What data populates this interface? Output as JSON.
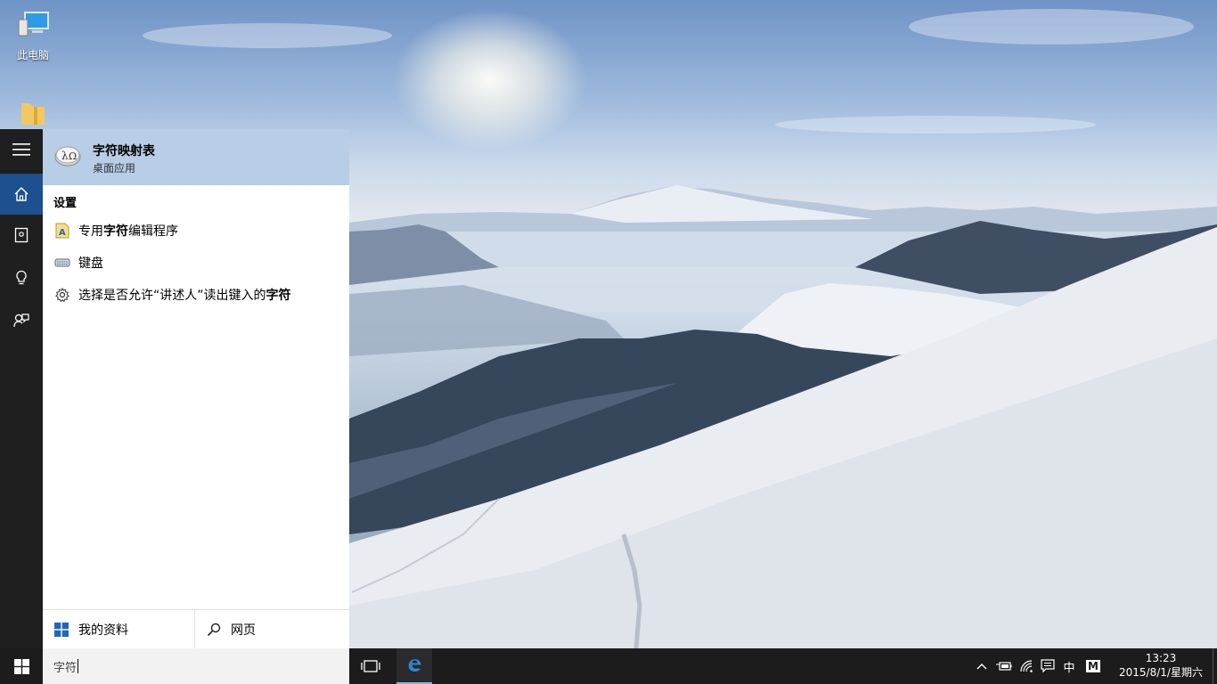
{
  "desktop": {
    "icons": [
      {
        "label": "此电脑",
        "icon": "computer-icon"
      },
      {
        "label": "",
        "icon": "folder-icon"
      }
    ]
  },
  "start_rail": {
    "items": [
      {
        "icon": "hamburger-menu-icon"
      },
      {
        "icon": "home-icon",
        "active": true
      },
      {
        "icon": "notebook-icon"
      },
      {
        "icon": "lightbulb-icon"
      },
      {
        "icon": "feedback-icon"
      }
    ]
  },
  "search_results": {
    "best_match": {
      "title": "字符映射表",
      "subtitle": "桌面应用",
      "icon": "character-map-icon"
    },
    "settings_header": "设置",
    "settings": [
      {
        "prefix": "专用",
        "bold": "字符",
        "suffix": "编辑程序",
        "icon": "edit-char-icon"
      },
      {
        "prefix": "键盘",
        "bold": "",
        "suffix": "",
        "icon": "keyboard-icon"
      },
      {
        "prefix": "选择是否允许“讲述人”读出键入的",
        "bold": "字符",
        "suffix": "",
        "icon": "gear-icon"
      }
    ],
    "tabs": {
      "my_stuff": "我的资料",
      "web": "网页"
    }
  },
  "taskbar": {
    "search_value": "字符",
    "tray": {
      "ime": "中",
      "ime_mode": "M"
    },
    "clock": {
      "time": "13:23",
      "date": "2015/8/1/星期六"
    }
  },
  "colors": {
    "best_match_highlight": "#b8cde6",
    "active_rail": "#1e4f8e",
    "taskbar": "#1c1c1c",
    "rail": "#1f1f1f"
  }
}
